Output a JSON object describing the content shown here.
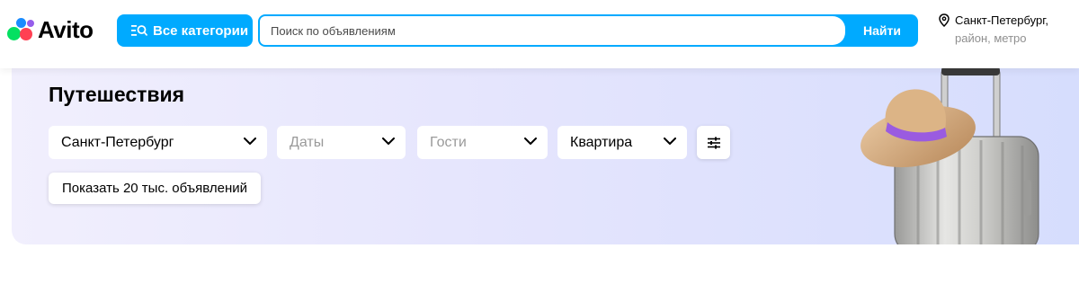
{
  "colors": {
    "accent": "#00aaff",
    "logo_green": "#04e061",
    "logo_blue": "#1a8cff",
    "logo_red": "#ff4053",
    "logo_purple": "#965eeb"
  },
  "header": {
    "logo_text": "Avito",
    "categories_button": {
      "label": "Все категории",
      "icon": "list-search-icon"
    },
    "search": {
      "placeholder": "Поиск по объявлениям",
      "button_label": "Найти"
    },
    "location": {
      "icon": "location-pin-icon",
      "city": "Санкт-Петербург,",
      "sub": "район, метро"
    }
  },
  "banner": {
    "title": "Путешествия",
    "filters": [
      {
        "value": "Санкт-Петербург",
        "placeholder": false
      },
      {
        "value": "Даты",
        "placeholder": true
      },
      {
        "value": "Гости",
        "placeholder": true
      },
      {
        "value": "Квартира",
        "placeholder": false
      }
    ],
    "filter_settings_icon": "sliders-icon",
    "show_button": "Показать 20 тыс. объявлений",
    "illustration": "suitcase-with-hat-image"
  }
}
